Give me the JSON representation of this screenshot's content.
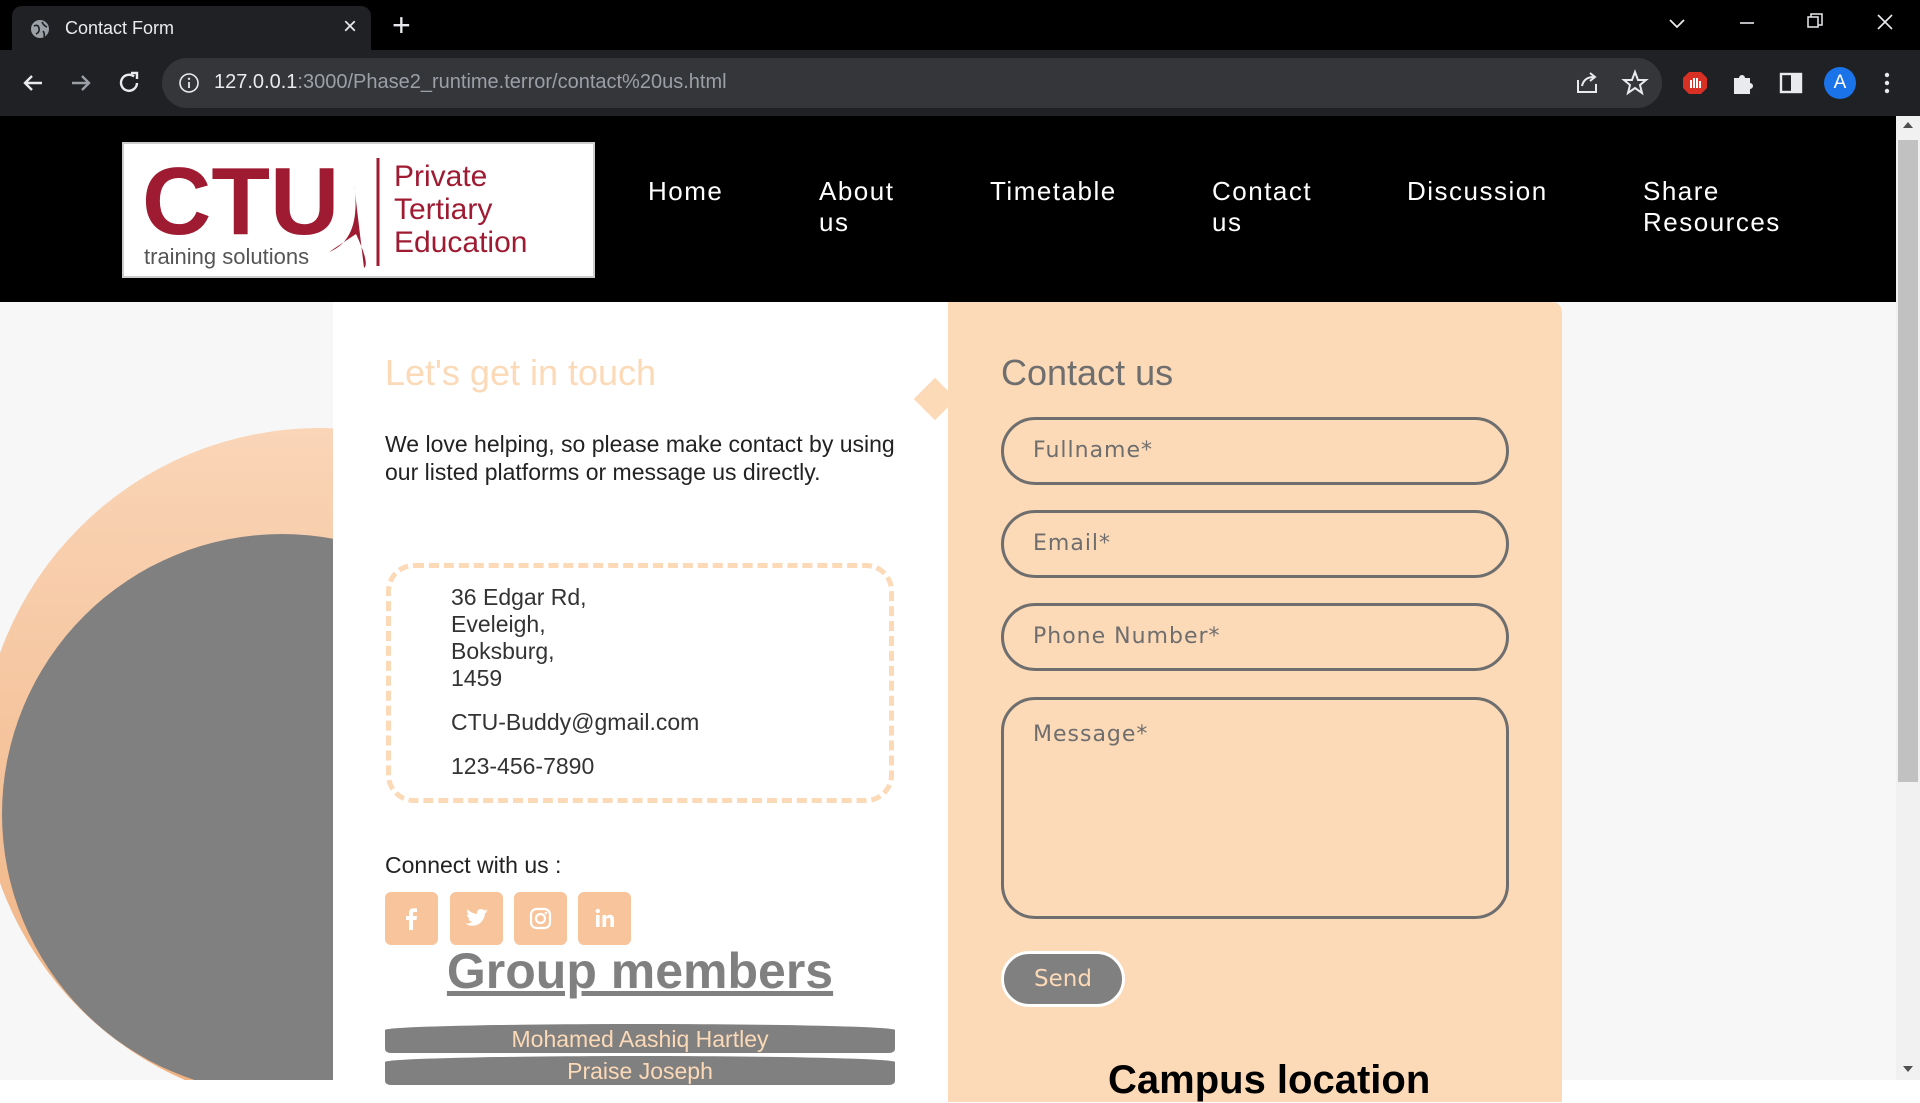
{
  "browser": {
    "tab_title": "Contact Form",
    "new_tab": "+",
    "url_host": "127.0.0.1",
    "url_rest": ":3000/Phase2_runtime.terror/contact%20us.html",
    "profile_initial": "A"
  },
  "site": {
    "logo": {
      "brand": "CTU",
      "tagline": "training solutions",
      "line1": "Private",
      "line2": "Tertiary",
      "line3": "Education"
    },
    "nav": [
      {
        "label": "Home"
      },
      {
        "label": "About us"
      },
      {
        "label": "Timetable"
      },
      {
        "label": "Contact us"
      },
      {
        "label": "Discussion"
      },
      {
        "label": "Share Resources"
      }
    ]
  },
  "touch": {
    "title": "Let's get in touch",
    "text": "We love helping, so please make contact by using our listed platforms or message us directly.",
    "address": [
      "36 Edgar Rd,",
      "Eveleigh,",
      "Boksburg,",
      "1459"
    ],
    "email": "CTU-Buddy@gmail.com",
    "phone": "123-456-7890",
    "connect": "Connect with us :",
    "social": [
      "facebook-icon",
      "twitter-icon",
      "instagram-icon",
      "linkedin-icon"
    ]
  },
  "group": {
    "title": "Group members",
    "members": [
      "Mohamed Aashiq Hartley",
      "Praise Joseph"
    ]
  },
  "form": {
    "title": "Contact us",
    "fullname_placeholder": "Fullname*",
    "email_placeholder": "Email*",
    "phone_placeholder": "Phone Number*",
    "message_placeholder": "Message*",
    "send_label": "Send",
    "campus_heading": "Campus location"
  },
  "colors": {
    "peach": "#fcd9b7",
    "grey": "#808080",
    "header": "#000000"
  }
}
